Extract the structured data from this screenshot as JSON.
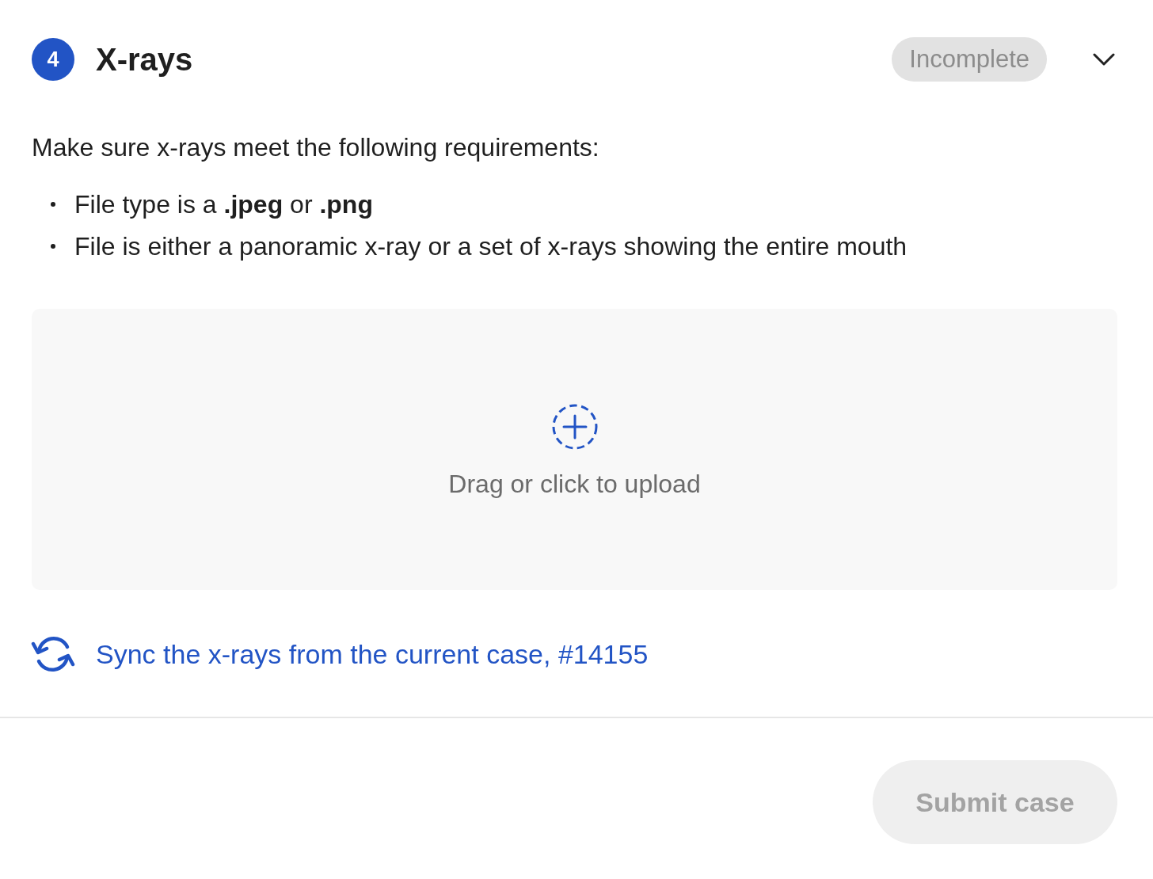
{
  "section": {
    "step_number": "4",
    "title": "X-rays",
    "status": "Incomplete",
    "expanded": true
  },
  "instructions": {
    "intro": "Make sure x-rays meet the following requirements:",
    "requirements": [
      "File type is a **.jpeg** or **.png**",
      "File is either a panoramic x-ray or a set of x-rays showing the entire mouth"
    ]
  },
  "upload": {
    "label": "Drag or click to upload"
  },
  "sync_link": {
    "label": "Sync the x-rays from the current case, #14155"
  },
  "footer": {
    "submit_button": {
      "label": "Submit case",
      "disabled": true
    }
  }
}
